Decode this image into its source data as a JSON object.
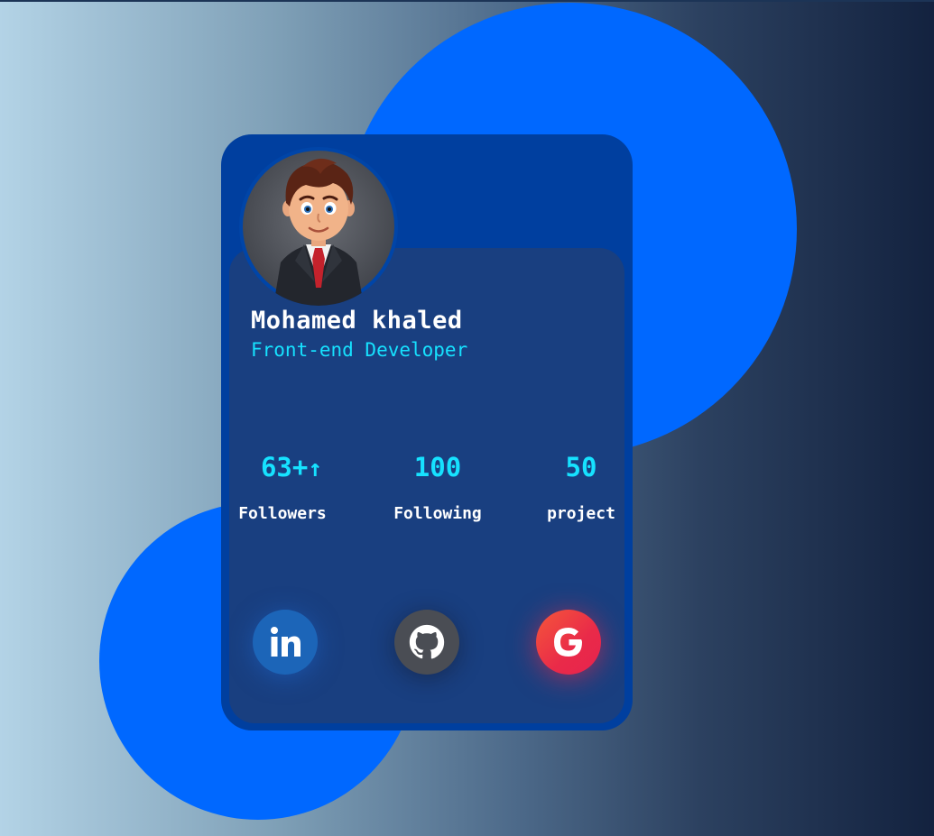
{
  "profile": {
    "name": "Mohamed khaled",
    "role": "Front-end Developer"
  },
  "stats": [
    {
      "value": "63+",
      "label": "Followers",
      "trend_icon": "arrow-up-icon"
    },
    {
      "value": "100",
      "label": "Following"
    },
    {
      "value": "50",
      "label": "project"
    }
  ],
  "social": [
    {
      "name": "LinkedIn",
      "icon": "linkedin-icon",
      "color": "#1c65b8"
    },
    {
      "name": "GitHub",
      "icon": "github-icon",
      "color": "#4a4d54"
    },
    {
      "name": "Google",
      "icon": "google-icon",
      "color": "#ec3848"
    }
  ],
  "colors": {
    "accent": "#16e2ff",
    "card": "#003f9f",
    "card_inner": "#193f80",
    "blob": "#0068ff"
  }
}
